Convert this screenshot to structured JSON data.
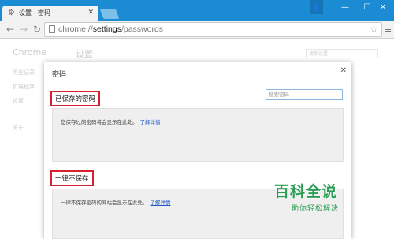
{
  "tab": {
    "title": "设置 - 密码"
  },
  "address": {
    "scheme": "chrome://",
    "host": "settings",
    "path": "/passwords"
  },
  "background": {
    "side_title": "Chrome",
    "side_items": [
      "历史记录",
      "扩展程序",
      "设置",
      "关于"
    ],
    "main_title": "设置",
    "search_placeholder": "搜索设置"
  },
  "dialog": {
    "title": "密码",
    "saved_label": "已保存的密码",
    "search_placeholder": "搜索密码",
    "saved_msg": "您保存过的密码将会显示在此处。",
    "learn_more": "了解详情",
    "never_label": "一律不保存",
    "never_msg": "一律不保存密码的网站会显示在此处。"
  },
  "watermark": {
    "big": "百科全说",
    "small": "助你轻松解决"
  },
  "colors": {
    "titlebar": "#1b8bd4",
    "highlight_border": "#d9202f",
    "link": "#1a56c4",
    "watermark": "#2a9f53"
  }
}
